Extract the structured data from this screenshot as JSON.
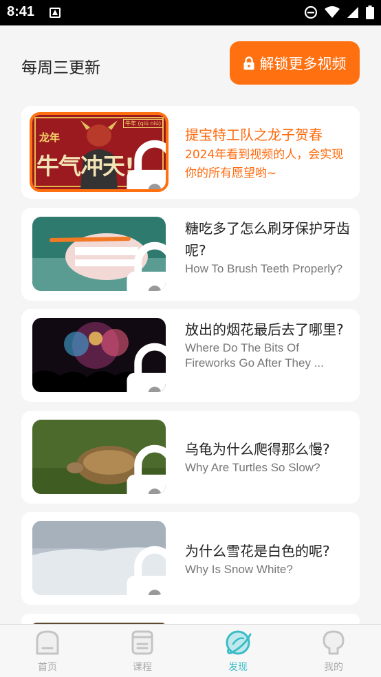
{
  "status_bar": {
    "time": "8:41"
  },
  "header": {
    "title": "每周三更新",
    "unlock_label": "解锁更多视频"
  },
  "colors": {
    "accent": "#ff7011",
    "nav_active": "#3cbcc5"
  },
  "featured": {
    "title": "提宝特工队之龙子贺春",
    "subtitle": "2024年看到视频的人，会实现你的所有愿望哟~",
    "thumb_text": "牛气冲天!",
    "thumb_badge": "龙年",
    "thumb_tag": "牛年 (qiú niú)"
  },
  "videos": [
    {
      "title_cn": "糖吃多了怎么刷牙保护牙齿呢?",
      "title_en": "How To Brush Teeth Properly?",
      "thumb": "teeth-model"
    },
    {
      "title_cn": "放出的烟花最后去了哪里?",
      "title_en": "Where Do The Bits Of Fireworks Go After They ...",
      "thumb": "fireworks"
    },
    {
      "title_cn": "乌龟为什么爬得那么慢?",
      "title_en": "Why Are Turtles So Slow?",
      "thumb": "turtle"
    },
    {
      "title_cn": "为什么雪花是白色的呢?",
      "title_en": "Why Is Snow White?",
      "thumb": "snow"
    }
  ],
  "bottom_nav": [
    {
      "label": "首页",
      "icon": "home-icon",
      "active": false
    },
    {
      "label": "课程",
      "icon": "course-icon",
      "active": false
    },
    {
      "label": "发现",
      "icon": "discover-icon",
      "active": true
    },
    {
      "label": "我的",
      "icon": "profile-icon",
      "active": false
    }
  ]
}
